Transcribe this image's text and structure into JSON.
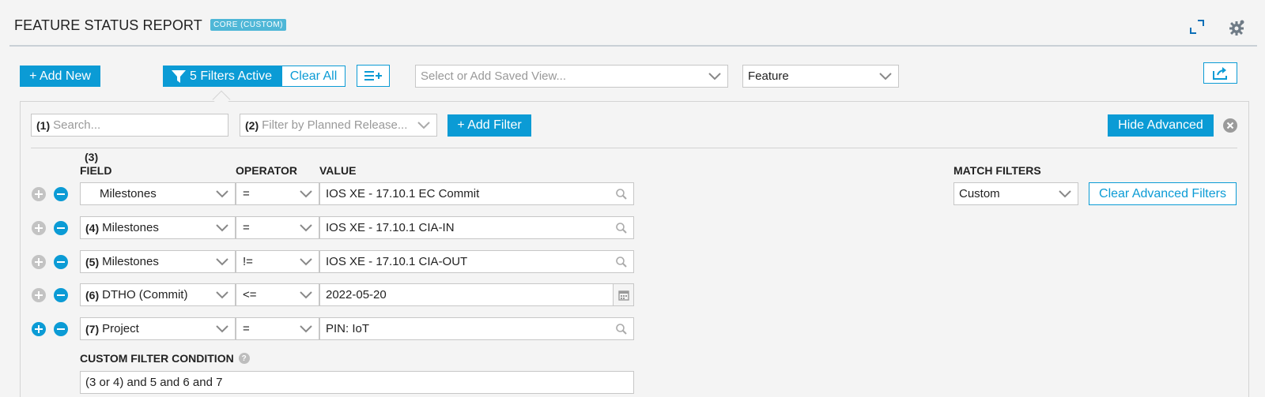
{
  "header": {
    "title": "FEATURE STATUS REPORT",
    "badge": "CORE (CUSTOM)"
  },
  "toolbar": {
    "add_new": "+ Add New",
    "filters_active": "5 Filters Active",
    "clear_all": "Clear All",
    "saved_view_placeholder": "Select or Add Saved View...",
    "type_select": "Feature"
  },
  "filter_bar": {
    "search_num": "(1)",
    "search_placeholder": "Search...",
    "release_num": "(2)",
    "release_placeholder": "Filter by Planned Release...",
    "add_filter": "+ Add Filter",
    "hide_advanced": "Hide Advanced"
  },
  "advanced": {
    "first_num": "(3)",
    "headers": {
      "field": "FIELD",
      "operator": "OPERATOR",
      "value": "VALUE",
      "match": "MATCH FILTERS"
    },
    "rows": [
      {
        "num": "",
        "field": "Milestones",
        "operator": "=",
        "value": "IOS XE - 17.10.1 EC Commit",
        "value_icon": "search-icon"
      },
      {
        "num": "(4)",
        "field": "Milestones",
        "operator": "=",
        "value": "IOS XE - 17.10.1 CIA-IN",
        "value_icon": "search-icon"
      },
      {
        "num": "(5)",
        "field": "Milestones",
        "operator": "!=",
        "value": "IOS XE - 17.10.1 CIA-OUT",
        "value_icon": "search-icon"
      },
      {
        "num": "(6)",
        "field": "DTHO (Commit)",
        "operator": "<=",
        "value": "2022-05-20",
        "value_icon": "calendar-icon"
      },
      {
        "num": "(7)",
        "field": "Project",
        "operator": "=",
        "value": "PIN: IoT",
        "value_icon": "search-icon"
      }
    ],
    "match_value": "Custom",
    "clear_advanced": "Clear Advanced Filters",
    "custom_condition_label": "CUSTOM FILTER CONDITION",
    "custom_condition_help": "?",
    "custom_condition_value": "(3 or 4) and 5 and 6 and 7"
  },
  "colors": {
    "accent": "#0b9bd5",
    "badge": "#4fb7d7",
    "background": "#f4f4f4"
  }
}
